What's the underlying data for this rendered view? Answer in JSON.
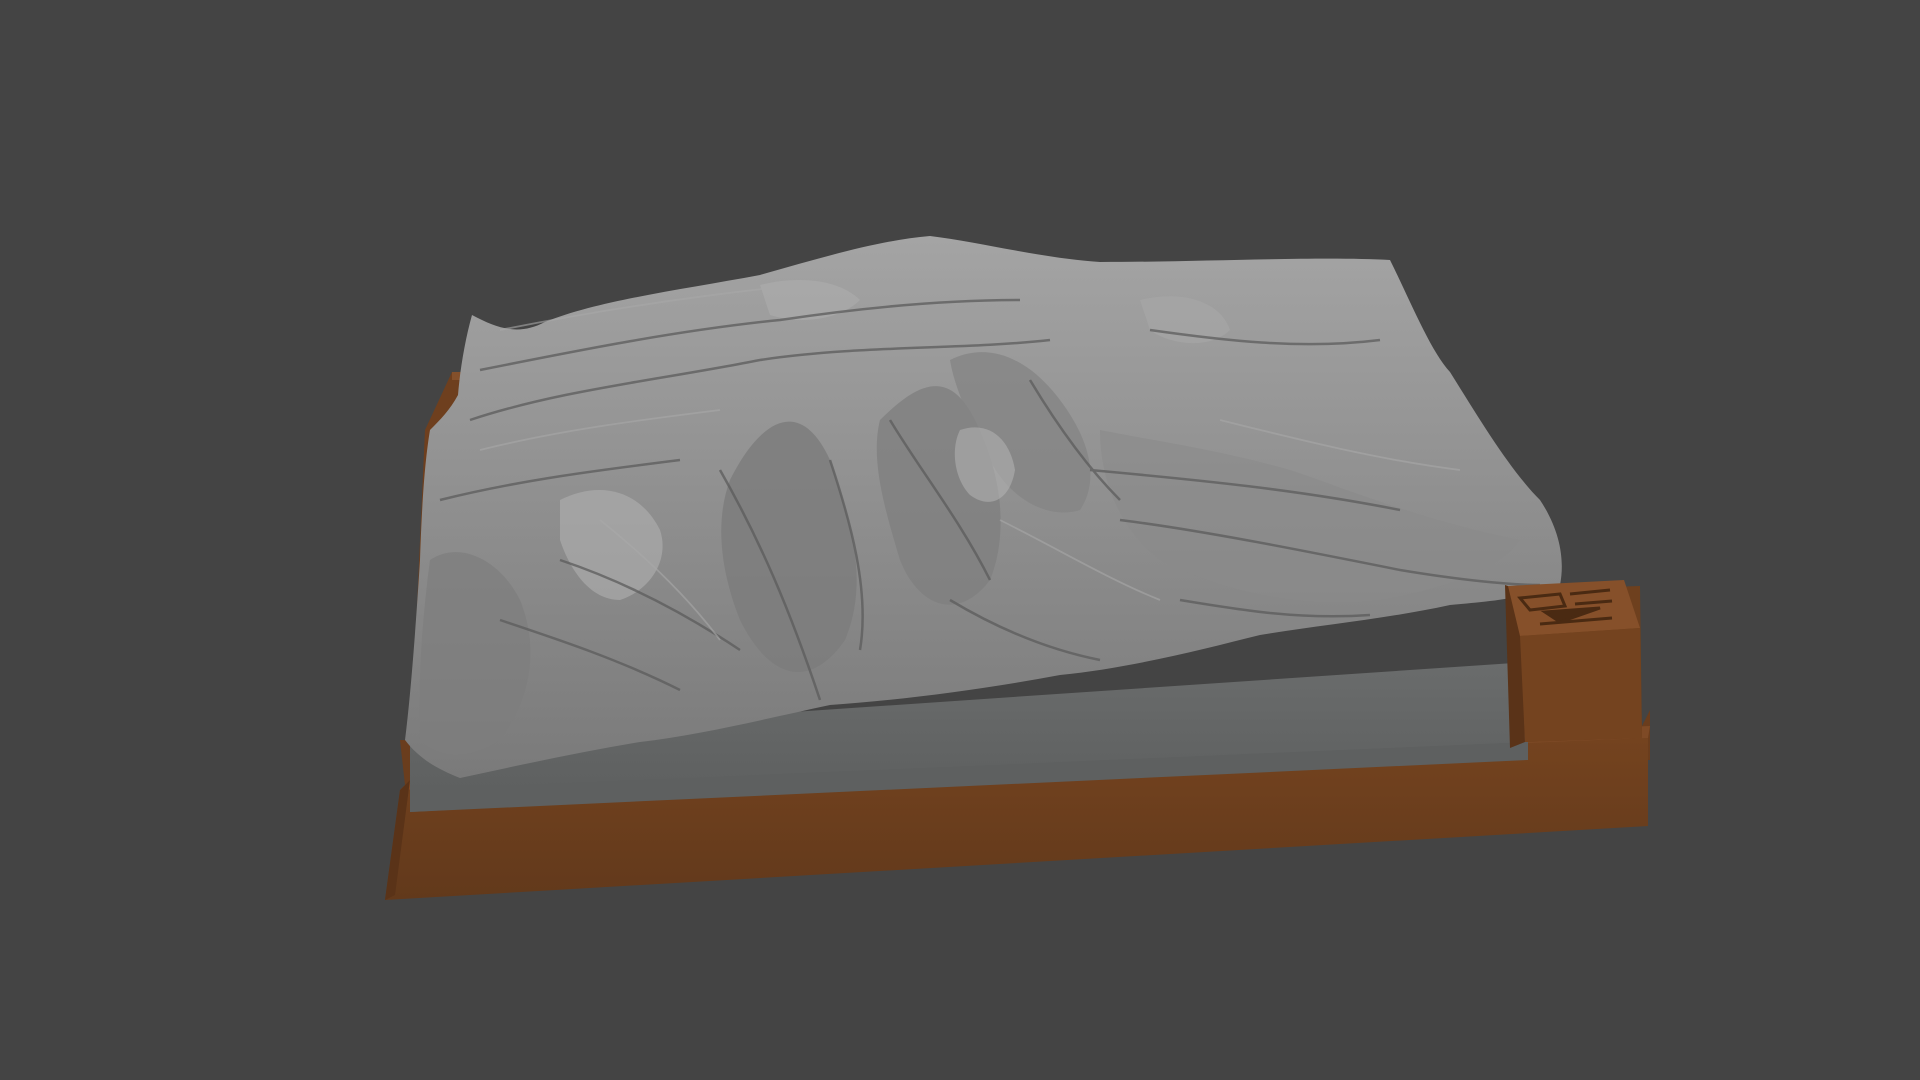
{
  "scene": {
    "subject": "terrain-relief-model",
    "colors": {
      "viewport_bg": "#444444",
      "terrain_light": "#9c9c9c",
      "terrain_mid": "#8a8a8a",
      "terrain_dark": "#5a5a5a",
      "terrain_side": "#606262",
      "base_front": "#6b3f1f",
      "base_top": "#7a4622",
      "base_shadow": "#5a3418",
      "tag_face": "#7b4724",
      "tag_top": "#86502a"
    },
    "icons": [
      "north-arrow-icon"
    ]
  }
}
